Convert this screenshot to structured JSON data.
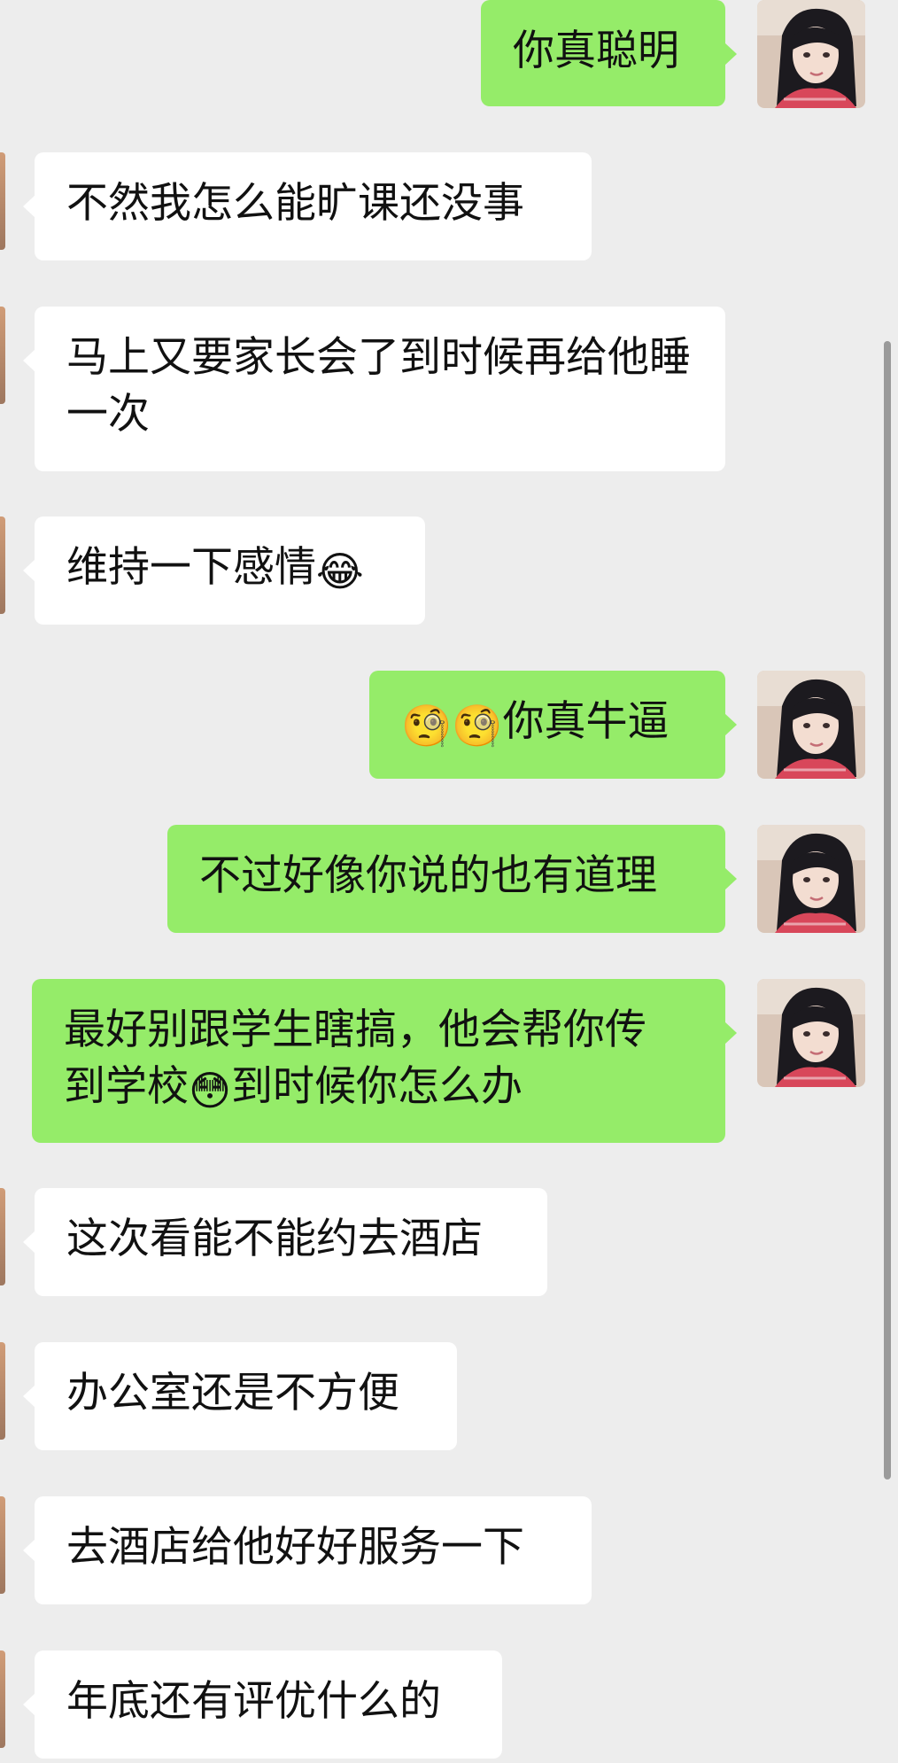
{
  "messages": [
    {
      "side": "out",
      "text": "你真聪明"
    },
    {
      "side": "in",
      "text": "不然我怎么能旷课还没事"
    },
    {
      "side": "in",
      "text": "马上又要家长会了到时候再给他睡一次"
    },
    {
      "side": "in",
      "text": "维持一下感情",
      "emoji_after": "😂"
    },
    {
      "side": "out",
      "emoji_before": "🧐🧐",
      "text": "你真牛逼"
    },
    {
      "side": "out",
      "text": "不过好像你说的也有道理"
    },
    {
      "side": "out",
      "text_line1": "最好别跟学生瞎搞，他会帮你传",
      "text_line2_a": "到学校",
      "emoji_mid": "😳",
      "text_line2_b": "到时候你怎么办"
    },
    {
      "side": "in",
      "text": "这次看能不能约去酒店"
    },
    {
      "side": "in",
      "text": "办公室还是不方便"
    },
    {
      "side": "in",
      "text": "去酒店给他好好服务一下"
    },
    {
      "side": "in",
      "text": "年底还有评优什么的"
    }
  ],
  "icons": {
    "sender_avatar": "girl-avatar-photo",
    "incoming_avatar": "avatar-edge-cropped"
  },
  "colors": {
    "background": "#ededed",
    "outgoing_bubble": "#95ec69",
    "incoming_bubble": "#ffffff",
    "text": "#111111",
    "scrollbar": "#9a9a9a"
  }
}
